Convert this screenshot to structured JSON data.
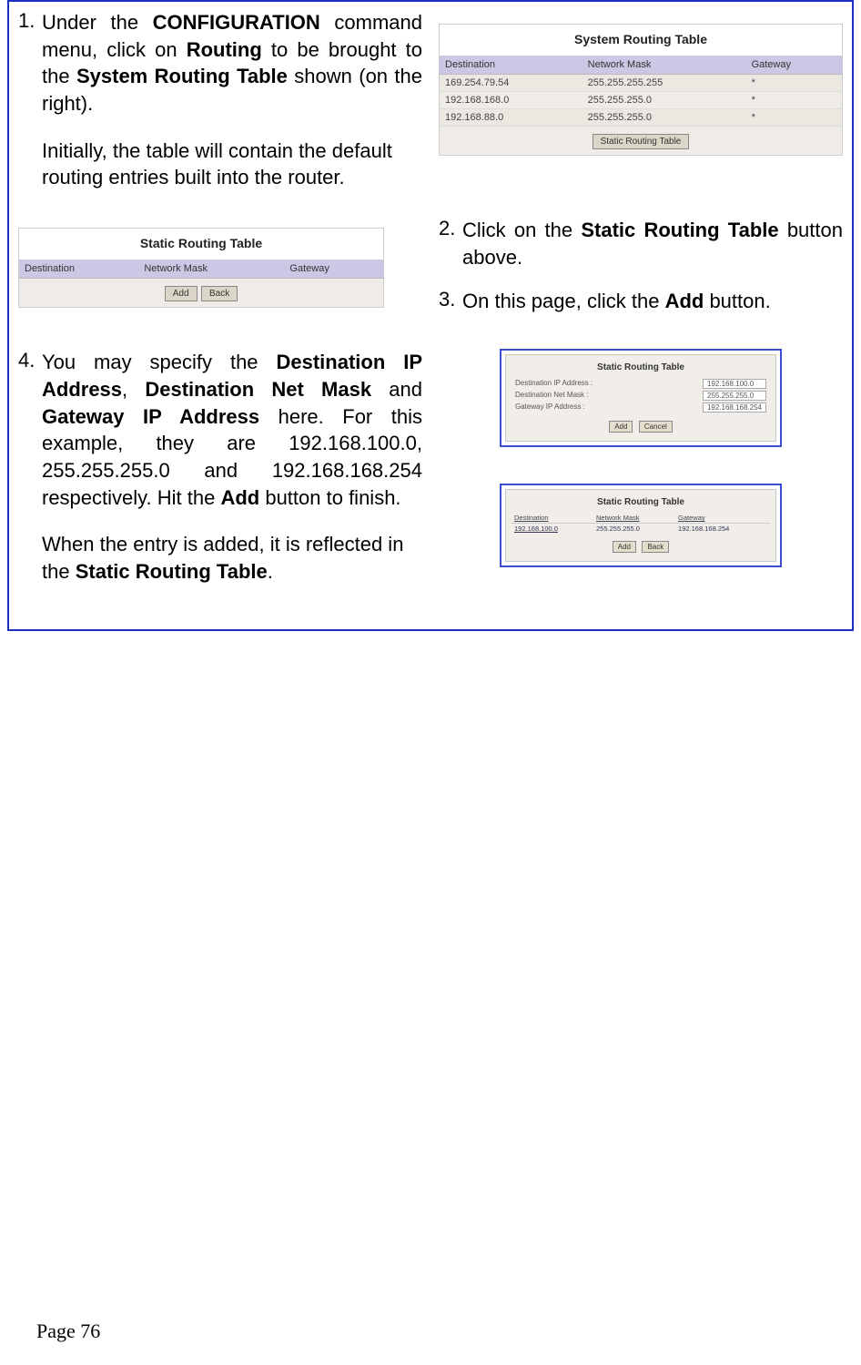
{
  "steps": {
    "s1": {
      "num": "1.",
      "t_a": "Under the ",
      "b_a": "CONFIGURATION",
      "t_b": " command menu, click on ",
      "b_b": "Routing",
      "t_c": " to be brought to the ",
      "b_c": "System Routing Table",
      "t_d": " shown (on the right).",
      "after": "Initially, the table will contain the default routing entries built into the router."
    },
    "s2": {
      "num": "2.",
      "t_a": "Click on the ",
      "b_a": "Static Routing Table",
      "t_b": " button above."
    },
    "s3": {
      "num": "3.",
      "t_a": "On this page, click the ",
      "b_a": "Add",
      "t_b": " button."
    },
    "s4": {
      "num": "4.",
      "t_a": "You may specify the ",
      "b_a": "Destination IP Address",
      "t_b": ", ",
      "b_b": "Destination Net Mask",
      "t_c": " and ",
      "b_c": "Gateway IP Address",
      "t_d": " here. For this example, they are 192.168.100.0, 255.255.255.0 and 192.168.168.254 respectively. Hit the ",
      "b_d": "Add",
      "t_e": " button to finish.",
      "after_a": "When the entry is added, it is reflected in the ",
      "after_b": "Static Routing Table",
      "after_c": "."
    }
  },
  "shot1": {
    "title": "System Routing Table",
    "headers": [
      "Destination",
      "Network Mask",
      "Gateway"
    ],
    "rows": [
      [
        "169.254.79.54",
        "255.255.255.255",
        "*"
      ],
      [
        "192.168.168.0",
        "255.255.255.0",
        "*"
      ],
      [
        "192.168.88.0",
        "255.255.255.0",
        "*"
      ]
    ],
    "button": "Static Routing Table"
  },
  "shot2": {
    "title": "Static Routing Table",
    "headers": [
      "Destination",
      "Network Mask",
      "Gateway"
    ],
    "btn_add": "Add",
    "btn_back": "Back"
  },
  "shot3": {
    "title": "Static Routing Table",
    "fields": [
      {
        "label": "Destination IP Address :",
        "value": "192.168.100.0"
      },
      {
        "label": "Destination Net Mask :",
        "value": "255.255.255.0"
      },
      {
        "label": "Gateway IP Address :",
        "value": "192.168.168.254"
      }
    ],
    "btn_add": "Add",
    "btn_cancel": "Cancel"
  },
  "shot4": {
    "title": "Static Routing Table",
    "headers": [
      "Destination",
      "Network Mask",
      "Gateway"
    ],
    "row": [
      "192.168.100.0",
      "255.255.255.0",
      "192.168.168.254"
    ],
    "btn_add": "Add",
    "btn_back": "Back"
  },
  "footer": {
    "page": "Page 76"
  }
}
